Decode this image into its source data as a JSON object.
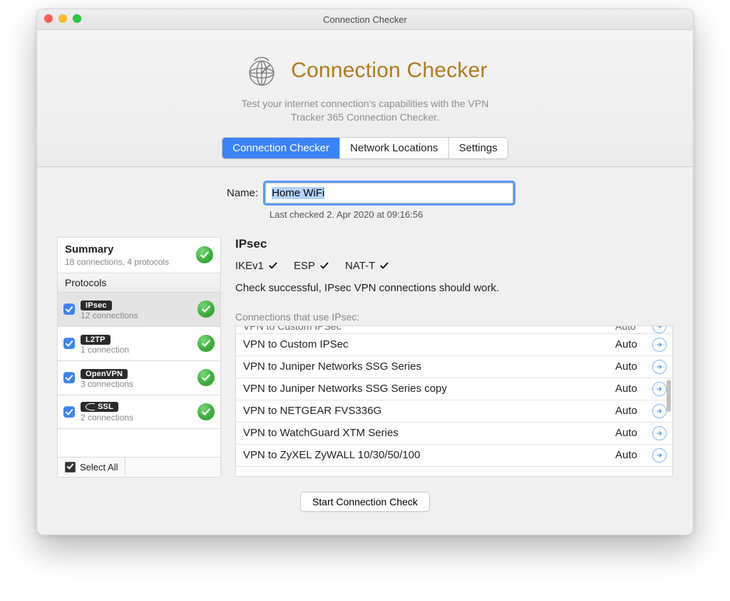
{
  "window": {
    "title": "Connection Checker"
  },
  "hero": {
    "title": "Connection Checker",
    "subline1": "Test your internet connection's capabilities with the VPN",
    "subline2": "Tracker 365 Connection Checker."
  },
  "tabs": {
    "items": [
      {
        "label": "Connection Checker",
        "active": true
      },
      {
        "label": "Network Locations",
        "active": false
      },
      {
        "label": "Settings",
        "active": false
      }
    ]
  },
  "name_row": {
    "label": "Name:",
    "value": "Home WiFi"
  },
  "last_checked": "Last checked 2. Apr 2020 at 09:16:56",
  "sidebar": {
    "summary_title": "Summary",
    "summary_sub": "18 connections, 4 protocols",
    "protocols_header": "Protocols",
    "select_all_label": "Select All",
    "protocols": [
      {
        "name": "IPsec",
        "sub": "12 connections",
        "checked": true,
        "selected": true,
        "ssl_icon": false
      },
      {
        "name": "L2TP",
        "sub": "1 connection",
        "checked": true,
        "selected": false,
        "ssl_icon": false
      },
      {
        "name": "OpenVPN",
        "sub": "3 connections",
        "checked": true,
        "selected": false,
        "ssl_icon": false
      },
      {
        "name": "SSL",
        "sub": "2 connections",
        "checked": true,
        "selected": false,
        "ssl_icon": true
      }
    ]
  },
  "detail": {
    "heading": "IPsec",
    "flags": [
      {
        "label": "IKEv1",
        "ok": true
      },
      {
        "label": "ESP",
        "ok": true
      },
      {
        "label": "NAT-T",
        "ok": true
      }
    ],
    "status_line": "Check successful, IPsec VPN connections should work.",
    "conn_header": "Connections that use IPsec:",
    "connections": [
      {
        "name": "VPN to Custom IPSec",
        "mode": "Auto",
        "clipped": true
      },
      {
        "name": "VPN to Custom IPSec",
        "mode": "Auto"
      },
      {
        "name": "VPN to Juniper Networks SSG Series",
        "mode": "Auto"
      },
      {
        "name": "VPN to Juniper Networks SSG Series copy",
        "mode": "Auto"
      },
      {
        "name": "VPN to NETGEAR FVS336G",
        "mode": "Auto"
      },
      {
        "name": "VPN to WatchGuard XTM Series",
        "mode": "Auto"
      },
      {
        "name": "VPN to ZyXEL ZyWALL 10/30/50/100",
        "mode": "Auto"
      }
    ]
  },
  "start_button": {
    "label": "Start Connection Check"
  }
}
